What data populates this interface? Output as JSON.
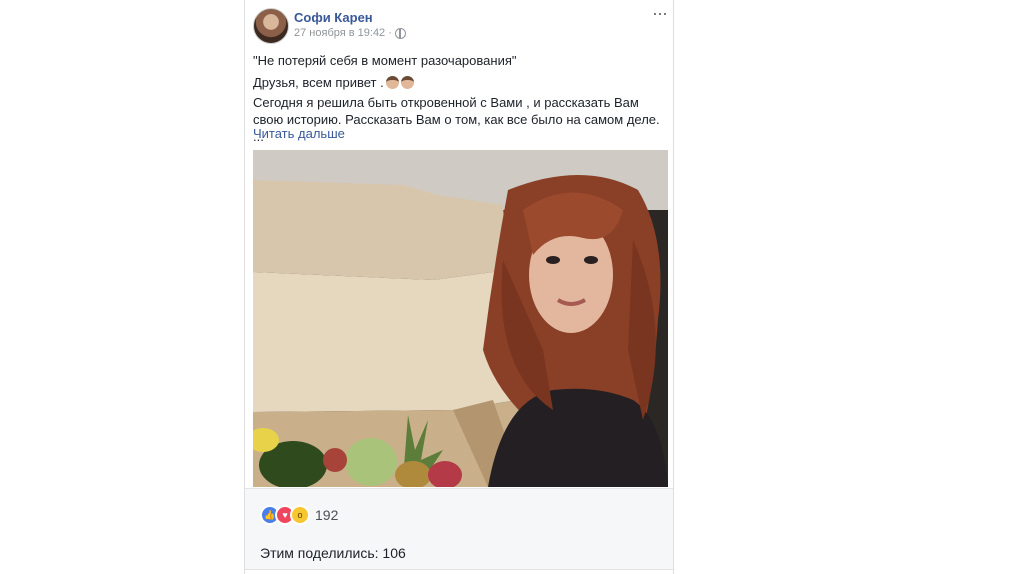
{
  "post": {
    "author": "Софи Карен",
    "date": "27 ноября в 19:42",
    "date_sep": "·",
    "menu_icon": "more-dots-icon",
    "line1": "\"Не потеряй себя в момент разочарования\"",
    "line2": "Друзья, всем привет .",
    "line3": "Сегодня я решила быть откровенной с Вами , и рассказать Вам свою историю. Рассказать Вам о том, как все было на самом деле. ...",
    "read_more": "Читать дальше"
  },
  "reactions": {
    "icons": [
      "like-icon",
      "love-icon",
      "wow-icon"
    ],
    "count": "192"
  },
  "shares": {
    "label": "Этим поделились: 106"
  },
  "colors": {
    "link": "#385898",
    "meta": "#90949c",
    "like": "#4a7ee8",
    "love": "#f0465d",
    "wow": "#f7c631"
  }
}
